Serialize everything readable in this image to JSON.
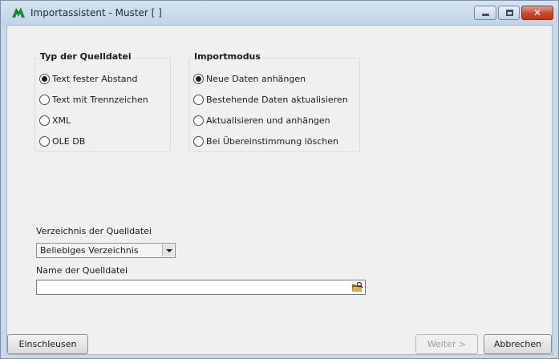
{
  "window": {
    "title": "Importassistent - Muster [ ]",
    "close_glyph": "✕"
  },
  "source_type": {
    "heading": "Typ der Quelldatei",
    "options": [
      {
        "label": "Text fester Abstand",
        "checked": true
      },
      {
        "label": "Text mit Trennzeichen",
        "checked": false
      },
      {
        "label": "XML",
        "checked": false
      },
      {
        "label": "OLE DB",
        "checked": false
      }
    ]
  },
  "import_mode": {
    "heading": "Importmodus",
    "options": [
      {
        "label": "Neue Daten anhängen",
        "checked": true
      },
      {
        "label": "Bestehende Daten aktualisieren",
        "checked": false
      },
      {
        "label": "Aktualisieren und anhängen",
        "checked": false
      },
      {
        "label": "Bei Übereinstimmung löschen",
        "checked": false
      }
    ]
  },
  "source_dir": {
    "label": "Verzeichnis der Quelldatei",
    "value": "Beliebiges Verzeichnis"
  },
  "source_file": {
    "label": "Name der Quelldatei",
    "value": ""
  },
  "buttons": {
    "load": "Einschleusen",
    "next": "Weiter >",
    "cancel": "Abbrechen"
  },
  "icons": {
    "app": "app-logo-icon",
    "browse": "folder-browse-icon"
  },
  "colors": {
    "titlebar": "#c1d4e8",
    "close_button": "#c8452b",
    "dialog_background": "#f0f0f0"
  }
}
